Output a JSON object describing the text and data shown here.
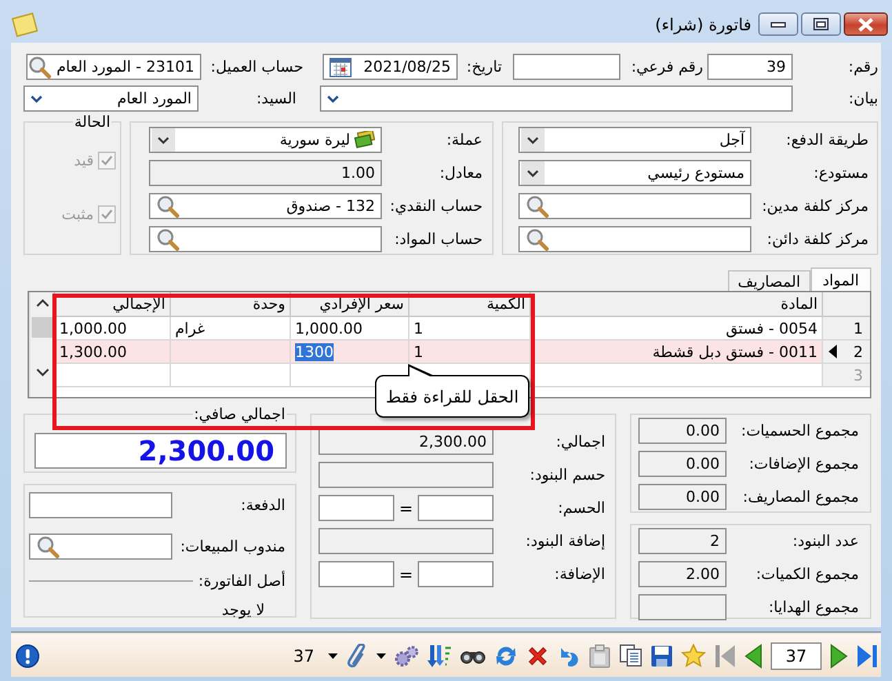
{
  "window": {
    "title": "فاتورة (شراء)"
  },
  "header": {
    "fields": [
      {
        "label": "رقم:",
        "kind": "text",
        "value": "39"
      },
      {
        "label": "رقم فرعي:",
        "kind": "text"
      },
      {
        "label": "تاريخ:",
        "kind": "date",
        "value": "2021/08/25"
      },
      {
        "label": "حساب العميل:",
        "kind": "lookup",
        "value": "23101 - المورد العام"
      },
      {
        "label": "بيان:",
        "kind": "dropdown"
      },
      {
        "label": "السيد:",
        "kind": "dropdown",
        "value": "المورد العام"
      }
    ]
  },
  "payment_panel": {
    "fields": [
      {
        "label": "طريقة الدفع:",
        "kind": "dropdown",
        "value": "آجل"
      },
      {
        "label": "مستودع:",
        "kind": "dropdown",
        "value": "مستودع رئيسي"
      },
      {
        "label": "مركز كلفة مدين:",
        "kind": "lookup"
      },
      {
        "label": "مركز كلفة دائن:",
        "kind": "lookup"
      }
    ]
  },
  "currency_panel": {
    "fields": [
      {
        "label": "عملة:",
        "kind": "currency",
        "value": "ليرة سورية"
      },
      {
        "label": "معادل:",
        "kind": "readonly",
        "value": "1.00"
      },
      {
        "label": "حساب النقدي:",
        "kind": "lookup",
        "value": "132 - صندوق"
      },
      {
        "label": "حساب المواد:",
        "kind": "lookup"
      }
    ]
  },
  "status_panel": {
    "title": "الحالة",
    "items": [
      {
        "label": "قيد",
        "checked": true,
        "disabled": true
      },
      {
        "label": "مثبت",
        "checked": true,
        "disabled": true
      }
    ]
  },
  "tabs": [
    {
      "label": "المواد",
      "selected": true
    },
    {
      "label": "المصاريف",
      "selected": false
    }
  ],
  "grid": {
    "columns": [
      "المادة",
      "الكمية",
      "سعر الإفرادي",
      "وحدة",
      "الإجمالي"
    ],
    "rows": [
      {
        "number": "1",
        "selected": false,
        "cells": [
          {
            "text": "0054 - فستق",
            "selected": false
          },
          {
            "text": "1",
            "selected": false
          },
          {
            "text": "1,000.00",
            "selected": false
          },
          {
            "text": "غرام",
            "selected": false
          },
          {
            "text": "1,000.00",
            "selected": false
          }
        ]
      },
      {
        "number": "2",
        "selected": true,
        "cells": [
          {
            "text": "0011 - فستق دبل قشطة",
            "selected": false
          },
          {
            "text": "1",
            "selected": false
          },
          {
            "text": "1300",
            "selected": true
          },
          {
            "text": "",
            "selected": false
          },
          {
            "text": "1,300.00",
            "selected": false
          }
        ]
      },
      {
        "number": "3",
        "selected": false
      }
    ]
  },
  "annotation": {
    "callout": "الحقل للقراءة فقط"
  },
  "net_total": {
    "label": "اجمالي صافي:",
    "value": "2,300.00"
  },
  "payment_details": {
    "fields": [
      {
        "label": "الدفعة:",
        "kind": "text"
      },
      {
        "label": "مندوب المبيعات:",
        "kind": "lookup"
      }
    ],
    "origin_label": "أصل الفاتورة:",
    "origin_value": "لا يوجد"
  },
  "discounts": {
    "fields": [
      {
        "label": "اجمالي:",
        "kind": "readonly",
        "value": "2,300.00"
      },
      {
        "label": "حسم البنود:",
        "kind": "readonly"
      },
      {
        "label": "الحسم:",
        "kind": "pair",
        "operator": "="
      },
      {
        "label": "إضافة البنود:",
        "kind": "readonly"
      },
      {
        "label": "الإضافة:",
        "kind": "pair",
        "operator": "="
      }
    ]
  },
  "sums": {
    "fields": [
      {
        "label": "مجموع الحسميات:",
        "kind": "readonly",
        "value": "0.00"
      },
      {
        "label": "مجموع الإضافات:",
        "kind": "readonly",
        "value": "0.00"
      },
      {
        "label": "مجموع المصاريف:",
        "kind": "readonly",
        "value": "0.00"
      }
    ]
  },
  "counts": {
    "fields": [
      {
        "label": "عدد البنود:",
        "kind": "readonly",
        "value": "2"
      },
      {
        "label": "مجموع الكميات:",
        "kind": "readonly",
        "value": "2.00"
      },
      {
        "label": "مجموع الهدايا:",
        "kind": "readonly"
      }
    ]
  },
  "toolbar": {
    "count": "37",
    "record_number": "37"
  }
}
